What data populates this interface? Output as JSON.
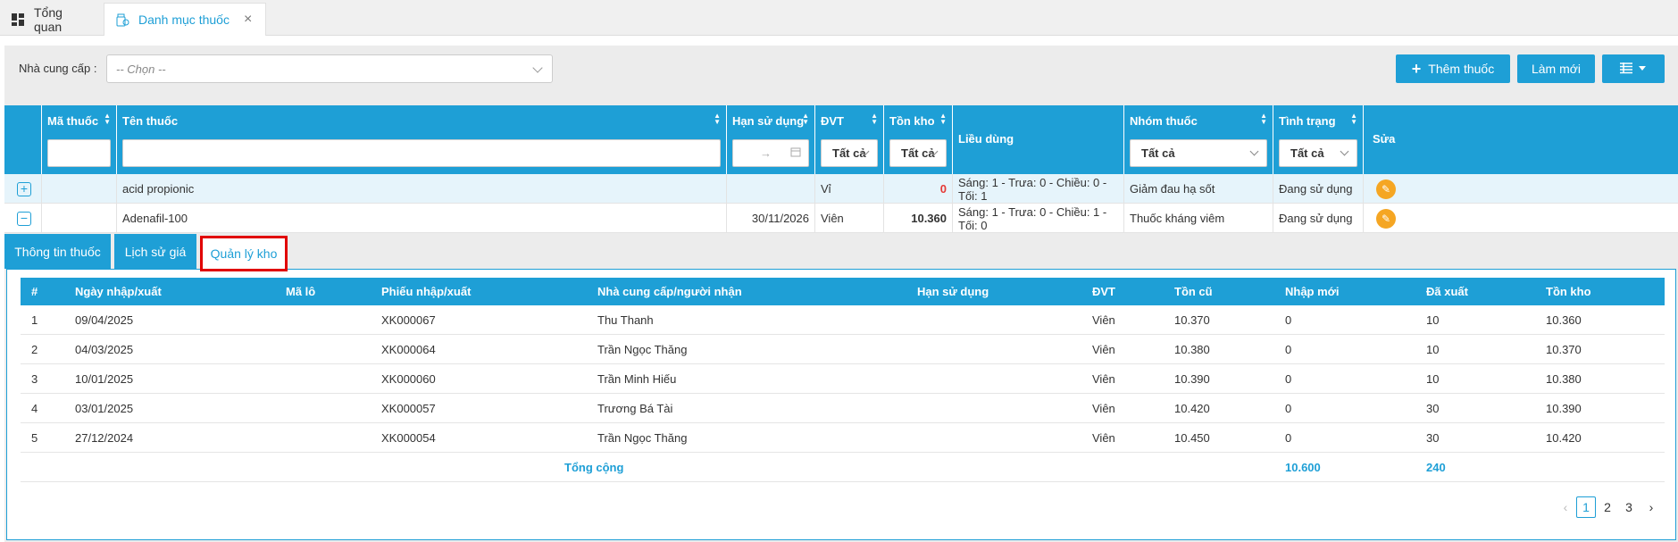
{
  "topbar": {
    "tabs": [
      {
        "label": "Tổng quan",
        "icon": "dashboard-icon"
      },
      {
        "label": "Danh mục thuốc",
        "icon": "medicine-icon",
        "close": "×"
      }
    ]
  },
  "filter": {
    "supplier_label": "Nhà cung cấp :",
    "supplier_placeholder": "-- Chọn --"
  },
  "toolbar": {
    "add_label": "Thêm thuốc",
    "refresh_label": "Làm mới",
    "columns_icon": "list-columns-icon"
  },
  "main_table": {
    "headers": {
      "code": "Mã thuốc",
      "name": "Tên thuốc",
      "expiry": "Hạn sử dụng",
      "unit": "ĐVT",
      "stock": "Tồn kho",
      "dosage": "Liều dùng",
      "group": "Nhóm thuốc",
      "status": "Tình trạng",
      "edit": "Sửa"
    },
    "filters": {
      "date_arrow": "→",
      "unit": "Tất cả",
      "stock": "Tất cả",
      "group": "Tất cả",
      "status": "Tất cả"
    },
    "rows": [
      {
        "expand": "+",
        "code": "",
        "name": "acid propionic",
        "expiry": "",
        "unit": "Vỉ",
        "stock": "0",
        "dosage": "Sáng: 1 - Trưa: 0 - Chiều: 0 - Tối: 1",
        "group": "Giảm đau hạ sốt",
        "status": "Đang sử dụng"
      },
      {
        "expand": "−",
        "code": "",
        "name": "Adenafil-100",
        "expiry": "30/11/2026",
        "unit": "Viên",
        "stock": "10.360",
        "dosage": "Sáng: 1 - Trưa: 0 - Chiều: 1 - Tối: 0",
        "group": "Thuốc kháng viêm",
        "status": "Đang sử dụng"
      }
    ]
  },
  "detail_tabs": [
    "Thông tin thuốc",
    "Lịch sử giá",
    "Quản lý kho"
  ],
  "stock_table": {
    "headers": [
      "#",
      "Ngày nhập/xuất",
      "Mã lô",
      "Phiếu nhập/xuất",
      "Nhà cung cấp/người nhận",
      "Hạn sử dụng",
      "ĐVT",
      "Tồn cũ",
      "Nhập mới",
      "Đã xuất",
      "Tồn kho"
    ],
    "rows": [
      [
        "1",
        "09/04/2025",
        "",
        "XK000067",
        "Thu Thanh",
        "",
        "Viên",
        "10.370",
        "0",
        "10",
        "10.360"
      ],
      [
        "2",
        "04/03/2025",
        "",
        "XK000064",
        "Trần Ngọc Thăng",
        "",
        "Viên",
        "10.380",
        "0",
        "10",
        "10.370"
      ],
      [
        "3",
        "10/01/2025",
        "",
        "XK000060",
        "Trần Minh Hiếu",
        "",
        "Viên",
        "10.390",
        "0",
        "10",
        "10.380"
      ],
      [
        "4",
        "03/01/2025",
        "",
        "XK000057",
        "Trương Bá Tài",
        "",
        "Viên",
        "10.420",
        "0",
        "30",
        "10.390"
      ],
      [
        "5",
        "27/12/2024",
        "",
        "XK000054",
        "Trần Ngọc Thăng",
        "",
        "Viên",
        "10.450",
        "0",
        "30",
        "10.420"
      ]
    ],
    "total": {
      "label": "Tổng cộng",
      "imported": "10.600",
      "exported": "240"
    }
  },
  "pagination": {
    "prev": "‹",
    "pages": [
      "1",
      "2",
      "3"
    ],
    "next": "›",
    "current": "1"
  }
}
